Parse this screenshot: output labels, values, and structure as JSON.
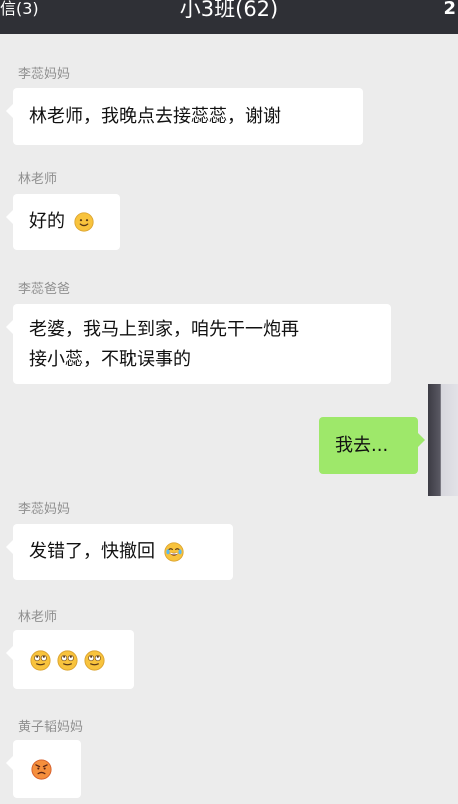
{
  "header": {
    "back_label": "信(3)",
    "title": "小3班(62)",
    "right_glyph": "2"
  },
  "messages": [
    {
      "sender": "李蕊妈妈",
      "text": "林老师，我晚点去接蕊蕊，谢谢",
      "side": "left"
    },
    {
      "sender": "林老师",
      "text": "好的",
      "emoji": "smile-face-icon",
      "side": "left"
    },
    {
      "sender": "李蕊爸爸",
      "lines": [
        "老婆，我马上到家，咱先干一炮再",
        "接小蕊，不耽误事的"
      ],
      "side": "left"
    },
    {
      "text": "我去...",
      "side": "right"
    },
    {
      "sender": "李蕊妈妈",
      "text": "发错了，快撤回",
      "emoji": "laugh-cry-face-icon",
      "side": "left"
    },
    {
      "sender": "林老师",
      "emojis": [
        "eyeroll-face-icon",
        "eyeroll-face-icon",
        "eyeroll-face-icon"
      ],
      "side": "left"
    },
    {
      "sender": "黄子韬妈妈",
      "emoji": "angry-face-icon",
      "side": "left"
    }
  ],
  "colors": {
    "header_bg": "#2f3036",
    "chat_bg": "#ececec",
    "incoming_bubble": "#ffffff",
    "outgoing_bubble": "#9ee86a"
  }
}
